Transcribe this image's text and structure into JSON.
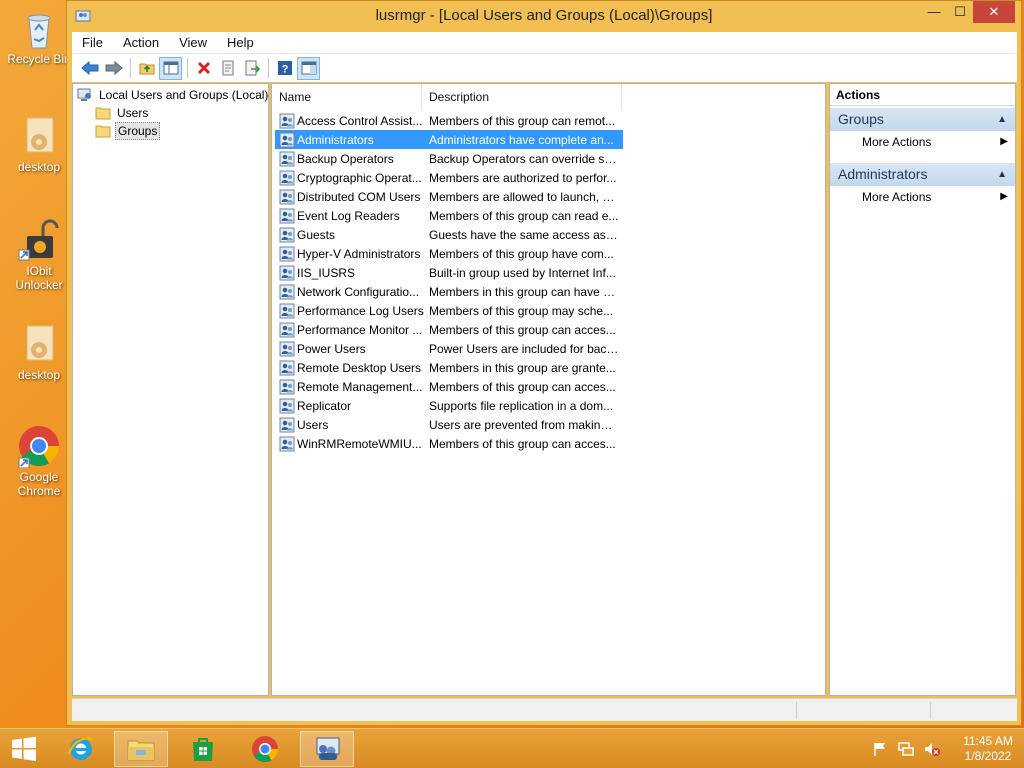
{
  "desktop": {
    "icons": [
      {
        "label": "Recycle Bin",
        "icon": "recycle-bin-icon"
      },
      {
        "label": "desktop",
        "icon": "folder-icon"
      },
      {
        "label": "IObit Unlocker",
        "icon": "lock-icon"
      },
      {
        "label": "desktop",
        "icon": "folder-icon"
      },
      {
        "label": "Google Chrome",
        "icon": "chrome-icon"
      }
    ]
  },
  "window": {
    "title": "lusrmgr - [Local Users and Groups (Local)\\Groups]",
    "controls": {
      "minimize": "—",
      "maximize": "☐",
      "close": "✕"
    }
  },
  "menu": [
    "File",
    "Action",
    "View",
    "Help"
  ],
  "toolbar": [
    "back",
    "forward",
    "up-folder",
    "show-hide-tree",
    "delete",
    "properties",
    "export",
    "help",
    "show-hide-action-pane"
  ],
  "tree": {
    "root": "Local Users and Groups (Local)",
    "children": [
      "Users",
      "Groups"
    ],
    "selected": "Groups"
  },
  "list": {
    "columns": [
      "Name",
      "Description"
    ],
    "selected_index": 1,
    "rows": [
      {
        "name": "Access Control Assist...",
        "desc": "Members of this group can remot..."
      },
      {
        "name": "Administrators",
        "desc": "Administrators have complete an..."
      },
      {
        "name": "Backup Operators",
        "desc": "Backup Operators can override se..."
      },
      {
        "name": "Cryptographic Operat...",
        "desc": "Members are authorized to perfor..."
      },
      {
        "name": "Distributed COM Users",
        "desc": "Members are allowed to launch, a..."
      },
      {
        "name": "Event Log Readers",
        "desc": "Members of this group can read e..."
      },
      {
        "name": "Guests",
        "desc": "Guests have the same access as m..."
      },
      {
        "name": "Hyper-V Administrators",
        "desc": "Members of this group have com..."
      },
      {
        "name": "IIS_IUSRS",
        "desc": "Built-in group used by Internet Inf..."
      },
      {
        "name": "Network Configuratio...",
        "desc": "Members in this group can have s..."
      },
      {
        "name": "Performance Log Users",
        "desc": "Members of this group may sche..."
      },
      {
        "name": "Performance Monitor ...",
        "desc": "Members of this group can acces..."
      },
      {
        "name": "Power Users",
        "desc": "Power Users are included for back..."
      },
      {
        "name": "Remote Desktop Users",
        "desc": "Members in this group are grante..."
      },
      {
        "name": "Remote Management...",
        "desc": "Members of this group can acces..."
      },
      {
        "name": "Replicator",
        "desc": "Supports file replication in a dom..."
      },
      {
        "name": "Users",
        "desc": "Users are prevented from making ..."
      },
      {
        "name": "WinRMRemoteWMIU...",
        "desc": "Members of this group can acces..."
      }
    ]
  },
  "actions": {
    "title": "Actions",
    "sections": [
      {
        "header": "Groups",
        "items": [
          "More Actions"
        ]
      },
      {
        "header": "Administrators",
        "items": [
          "More Actions"
        ]
      }
    ]
  },
  "taskbar": {
    "apps": [
      "internet-explorer-icon",
      "file-explorer-icon",
      "store-icon",
      "chrome-icon",
      "lusrmgr-icon"
    ],
    "active_app": "lusrmgr-icon"
  },
  "clock": {
    "time": "11:45 AM",
    "date": "1/8/2022"
  },
  "colors": {
    "accent": "#f2bf53",
    "selection": "#3399ff",
    "close": "#c7463a"
  }
}
